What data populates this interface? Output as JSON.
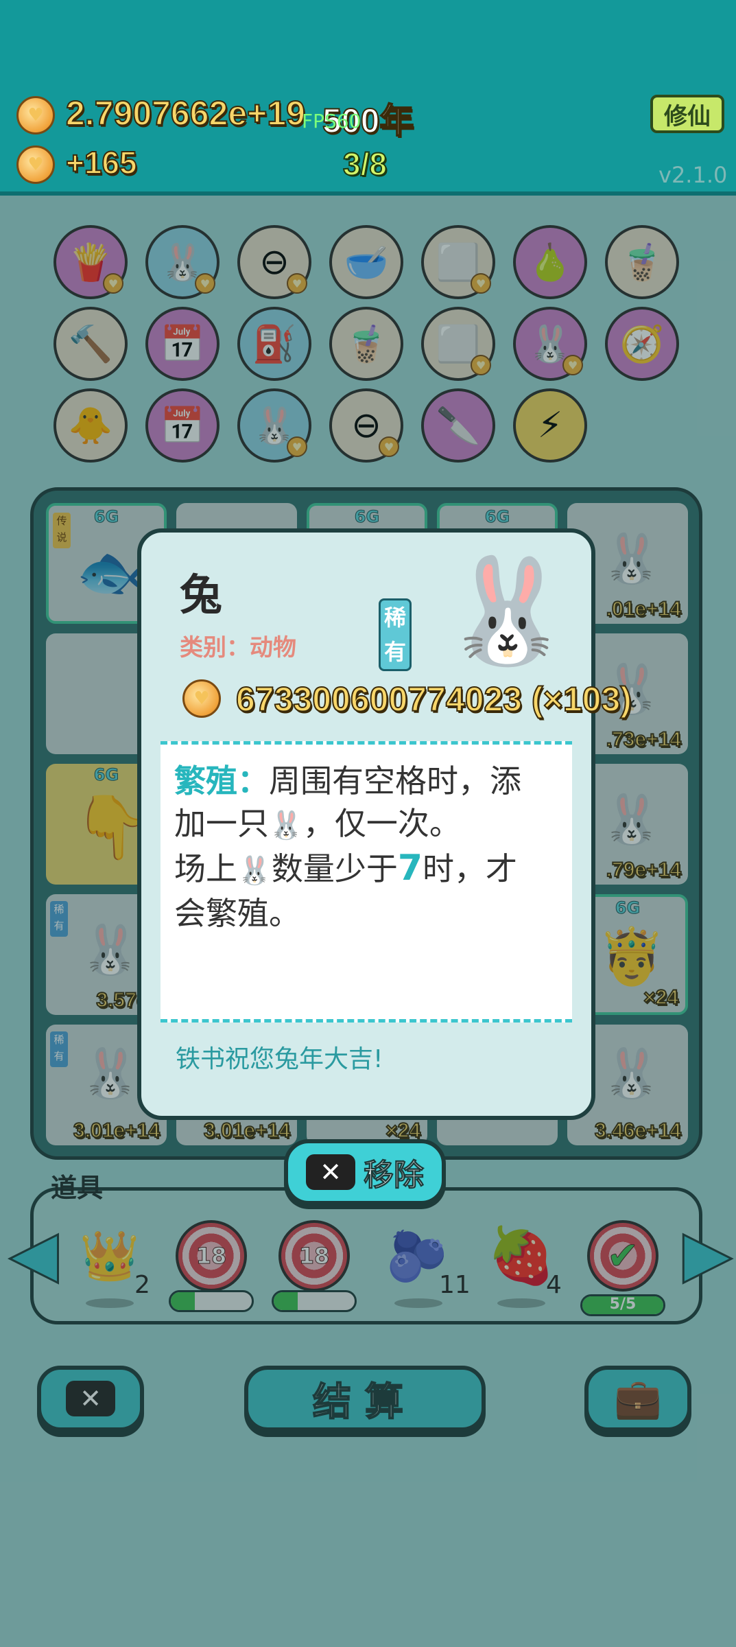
{
  "header": {
    "coins": "2.7907662e+19",
    "year": "500年",
    "fps": "FPS60",
    "income": "+165",
    "round": "3/8",
    "version": "v2.1.0",
    "xiuxian_button": "修仙"
  },
  "board": {
    "values": {
      "r1c1": "×",
      "r1c5": ".01e+14",
      "r2c5": ".73e+14",
      "r3c5": ".79e+14",
      "r4c1": "3.57e+",
      "r4c5": "×24",
      "r5c1": "3.01e+14",
      "r5c2": "3.01e+14",
      "r5c3": "×24",
      "r5c5": "3.46e+14",
      "r3c1": "×"
    },
    "six_g": "6G",
    "tag_legend": "传说",
    "tag_rare": "稀有"
  },
  "dialog": {
    "title": "兔",
    "category": "类别：动物",
    "rarity": "稀有",
    "value": "673300600774023 (×103)",
    "desc_keyword": "繁殖：",
    "desc_line1": "周围有空格时，添",
    "desc_line2a": "加一只",
    "desc_line2b": "，仅一次。",
    "desc_line3a": "场上",
    "desc_line3b": "数量少于",
    "desc_num": "7",
    "desc_line3c": "时，才",
    "desc_line4": "会繁殖。",
    "footer": "铁书祝您兔年大吉!"
  },
  "remove_button": "移除",
  "tools": {
    "label": "道具",
    "crown_count": "2",
    "target1": "18",
    "target1_progress": 0.3,
    "target2": "18",
    "target2_progress": 0.3,
    "blueberry_count": "11",
    "strawberry_count": "4",
    "check_progress_text": "5/5",
    "check_progress": 1.0
  },
  "bottom": {
    "settle_button": "结算"
  }
}
